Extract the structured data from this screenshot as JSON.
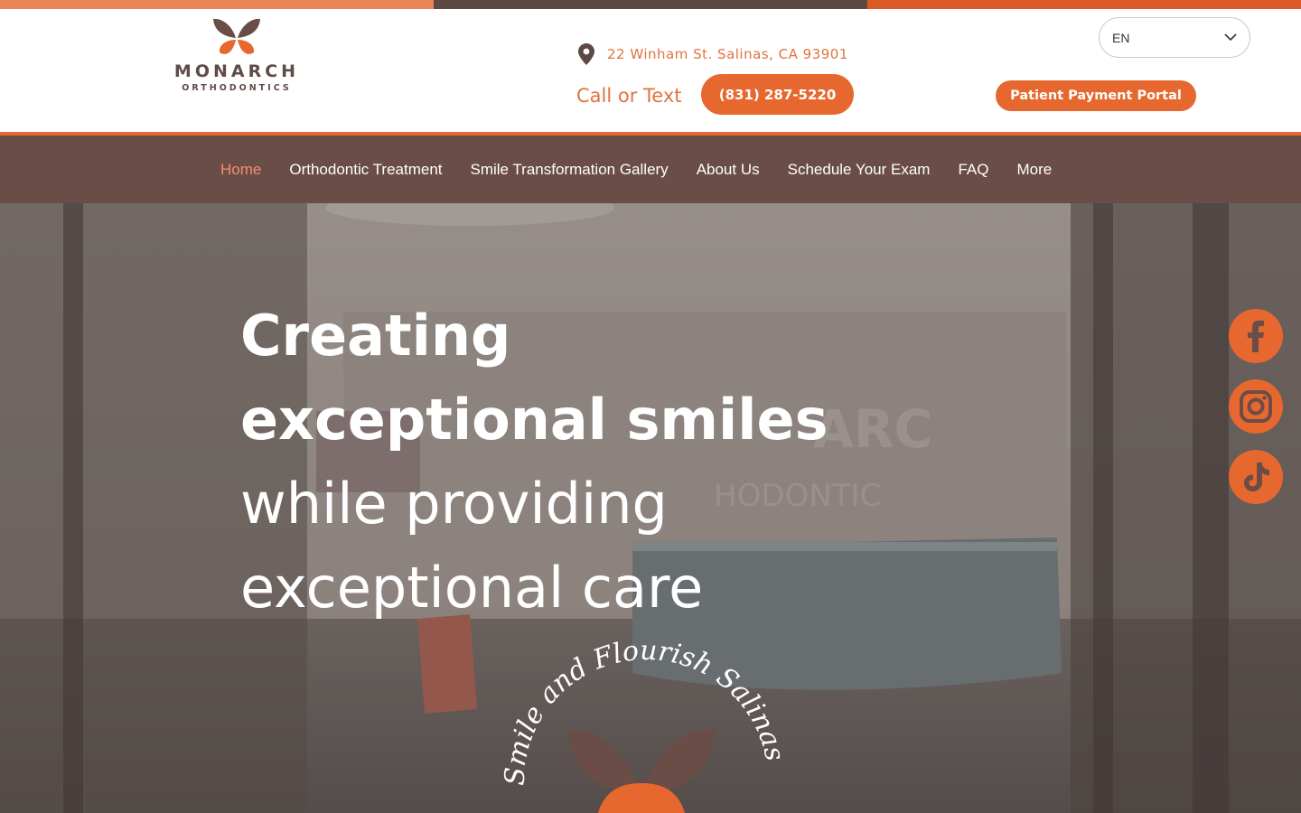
{
  "colors": {
    "accent": "#e7682f",
    "accent_text": "#e0743f",
    "nav_bg": "#6b4d47",
    "brand_brown": "#5f4b47",
    "active_nav": "#f0916a",
    "stripe": [
      "#e98458",
      "#5e4845",
      "#dc5a26"
    ]
  },
  "logo": {
    "name": "MONARCH",
    "subtitle": "ORTHODONTICS",
    "icon": "butterfly-logo"
  },
  "header": {
    "address": "22 Winham St. Salinas, CA 93901",
    "call_label": "Call or Text",
    "phone": "(831) 287-5220",
    "language": {
      "selected": "EN",
      "icon": "chevron-down-icon"
    },
    "portal_button": "Patient Payment Portal"
  },
  "nav": {
    "items": [
      {
        "label": "Home",
        "active": true
      },
      {
        "label": "Orthodontic Treatment",
        "active": false
      },
      {
        "label": "Smile Transformation Gallery",
        "active": false
      },
      {
        "label": "About Us",
        "active": false
      },
      {
        "label": "Schedule Your Exam",
        "active": false
      },
      {
        "label": "FAQ",
        "active": false
      },
      {
        "label": "More",
        "active": false
      }
    ]
  },
  "hero": {
    "line1": "Creating",
    "line2": "exceptional smiles",
    "line3": "while providing",
    "line4": "exceptional care",
    "tagline": "Smile and Flourish Salinas"
  },
  "social": [
    {
      "name": "facebook",
      "icon": "facebook-icon"
    },
    {
      "name": "instagram",
      "icon": "instagram-icon"
    },
    {
      "name": "tiktok",
      "icon": "tiktok-icon"
    }
  ]
}
